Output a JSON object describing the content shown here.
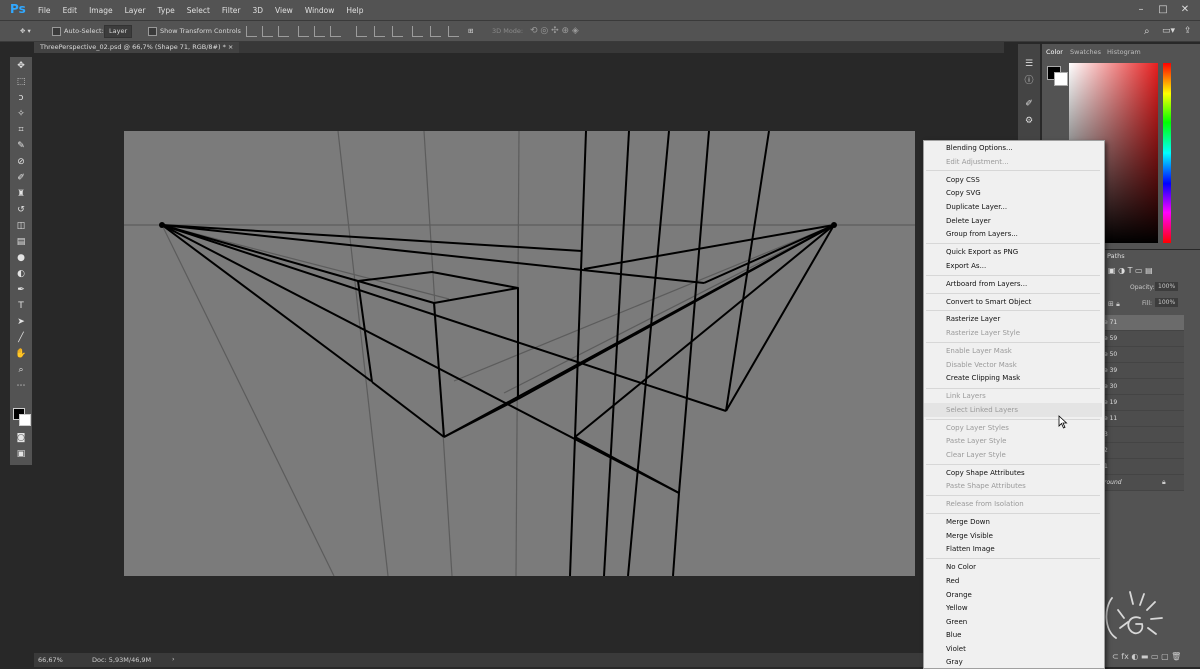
{
  "app": {
    "logo": "Ps"
  },
  "menubar": {
    "items": [
      "File",
      "Edit",
      "Image",
      "Layer",
      "Type",
      "Select",
      "Filter",
      "3D",
      "View",
      "Window",
      "Help"
    ]
  },
  "options": {
    "auto_select": "Auto-Select:",
    "layer_select": "Layer",
    "show_transform": "Show Transform Controls",
    "mode_3d": "3D Mode:"
  },
  "document": {
    "tab_title": "ThreePerspective_02.psd @ 66,7% (Shape 71, RGB/8#) *"
  },
  "status": {
    "zoom": "66,67%",
    "doc": "Doc: 5,93M/46,9M"
  },
  "color_panel": {
    "tabs": [
      "Color",
      "Swatches",
      "Histogram"
    ]
  },
  "layers_panel": {
    "tab": "Paths",
    "opacity_label": "Opacity:",
    "opacity_value": "100%",
    "fill_label": "Fill:",
    "fill_value": "100%",
    "rows": [
      "e 71",
      "e 59",
      "e 50",
      "e 39",
      "e 30",
      "e 19",
      "e 11",
      "3",
      "2",
      "1",
      "round"
    ]
  },
  "context_menu": {
    "items": [
      {
        "label": "Blending Options...",
        "enabled": true
      },
      {
        "label": "Edit Adjustment...",
        "enabled": false
      },
      {
        "label": "Copy CSS",
        "enabled": true
      },
      {
        "label": "Copy SVG",
        "enabled": true
      },
      {
        "label": "Duplicate Layer...",
        "enabled": true
      },
      {
        "label": "Delete Layer",
        "enabled": true
      },
      {
        "label": "Group from Layers...",
        "enabled": true
      },
      {
        "label": "Quick Export as PNG",
        "enabled": true
      },
      {
        "label": "Export As...",
        "enabled": true
      },
      {
        "label": "Artboard from Layers...",
        "enabled": true
      },
      {
        "label": "Convert to Smart Object",
        "enabled": true
      },
      {
        "label": "Rasterize Layer",
        "enabled": true
      },
      {
        "label": "Rasterize Layer Style",
        "enabled": false
      },
      {
        "label": "Enable Layer Mask",
        "enabled": false
      },
      {
        "label": "Disable Vector Mask",
        "enabled": false
      },
      {
        "label": "Create Clipping Mask",
        "enabled": true
      },
      {
        "label": "Link Layers",
        "enabled": false
      },
      {
        "label": "Select Linked Layers",
        "enabled": false
      },
      {
        "label": "Copy Layer Styles",
        "enabled": false
      },
      {
        "label": "Paste Layer Style",
        "enabled": false
      },
      {
        "label": "Clear Layer Style",
        "enabled": false
      },
      {
        "label": "Copy Shape Attributes",
        "enabled": true
      },
      {
        "label": "Paste Shape Attributes",
        "enabled": false
      },
      {
        "label": "Release from Isolation",
        "enabled": false
      },
      {
        "label": "Merge Down",
        "enabled": true
      },
      {
        "label": "Merge Visible",
        "enabled": true
      },
      {
        "label": "Flatten Image",
        "enabled": true
      },
      {
        "label": "No Color",
        "enabled": true
      },
      {
        "label": "Red",
        "enabled": true
      },
      {
        "label": "Orange",
        "enabled": true
      },
      {
        "label": "Yellow",
        "enabled": true
      },
      {
        "label": "Green",
        "enabled": true
      },
      {
        "label": "Blue",
        "enabled": true
      },
      {
        "label": "Violet",
        "enabled": true
      },
      {
        "label": "Gray",
        "enabled": true
      }
    ]
  },
  "icons": {
    "search": "search-icon",
    "workspace": "workspace-icon",
    "share": "share-icon"
  },
  "colors": {
    "ps_blue": "#31a8ff",
    "menu_bg": "#f0f0f0",
    "ui_bg": "#535353",
    "canvas_bg": "#7b7b7b"
  }
}
